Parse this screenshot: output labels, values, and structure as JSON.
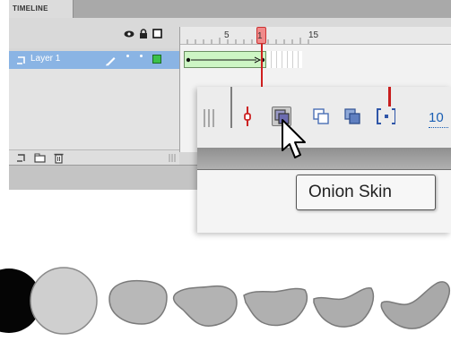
{
  "timeline": {
    "tab_label": "TIMELINE",
    "frame_numbers": [
      "5",
      "1",
      "15"
    ],
    "layer_name": "Layer 1",
    "icons": [
      "eye-icon",
      "lock-icon",
      "outline-icon",
      "layer-icon",
      "pencil-icon",
      "new-layer-icon",
      "new-folder-icon",
      "trash-icon"
    ]
  },
  "toolbar": {
    "frame_label": "10",
    "buttons": [
      "center-frame-button",
      "onion-skin-button",
      "onion-skin-outlines-button",
      "edit-multiple-frames-button",
      "modify-markers-button"
    ]
  },
  "tooltip": {
    "text": "Onion Skin"
  },
  "colors": {
    "accent_selection": "#8ab4e4",
    "playhead": "#d02020",
    "tween": "#cdf5c4",
    "shape_fill": "#b3b3b3",
    "shape_stroke": "#7a7a7a"
  }
}
